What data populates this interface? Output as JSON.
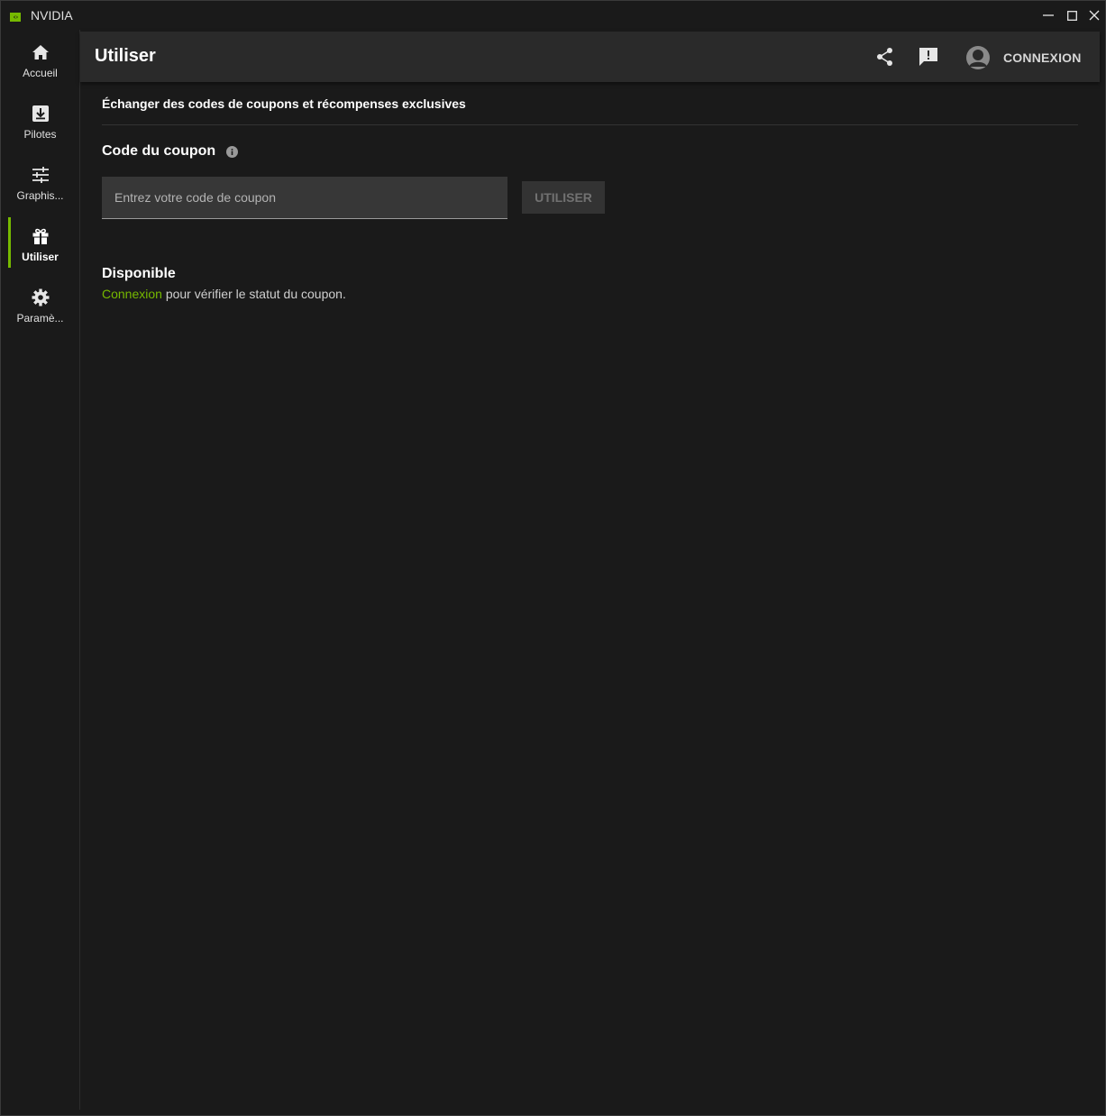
{
  "window": {
    "title": "NVIDIA",
    "controls": [
      "minimize-icon",
      "maximize-icon",
      "close-icon"
    ]
  },
  "sidebar": {
    "items": [
      {
        "label": "Accueil",
        "icon": "home-icon",
        "active": false
      },
      {
        "label": "Pilotes",
        "icon": "download-icon",
        "active": false
      },
      {
        "label": "Graphis...",
        "icon": "sliders-icon",
        "active": false
      },
      {
        "label": "Utiliser",
        "icon": "gift-icon",
        "active": true
      },
      {
        "label": "Paramè...",
        "icon": "gear-icon",
        "active": false
      }
    ]
  },
  "header": {
    "title": "Utiliser",
    "icons": [
      "share-icon",
      "feedback-icon"
    ],
    "login_label": "CONNEXION"
  },
  "main": {
    "subtitle": "Échanger des codes de coupons et récompenses exclusives",
    "coupon_label": "Code du coupon",
    "coupon_input": {
      "value": "",
      "placeholder": "Entrez votre code de coupon"
    },
    "redeem_button": "UTILISER",
    "available_title": "Disponible",
    "status_link": "Connexion",
    "status_text": " pour vérifier le statut du coupon."
  },
  "colors": {
    "accent": "#76b900",
    "background": "#1a1a1a",
    "header_bg": "#2a2a2a",
    "input_bg": "#373737",
    "button_disabled_bg": "#333333"
  }
}
